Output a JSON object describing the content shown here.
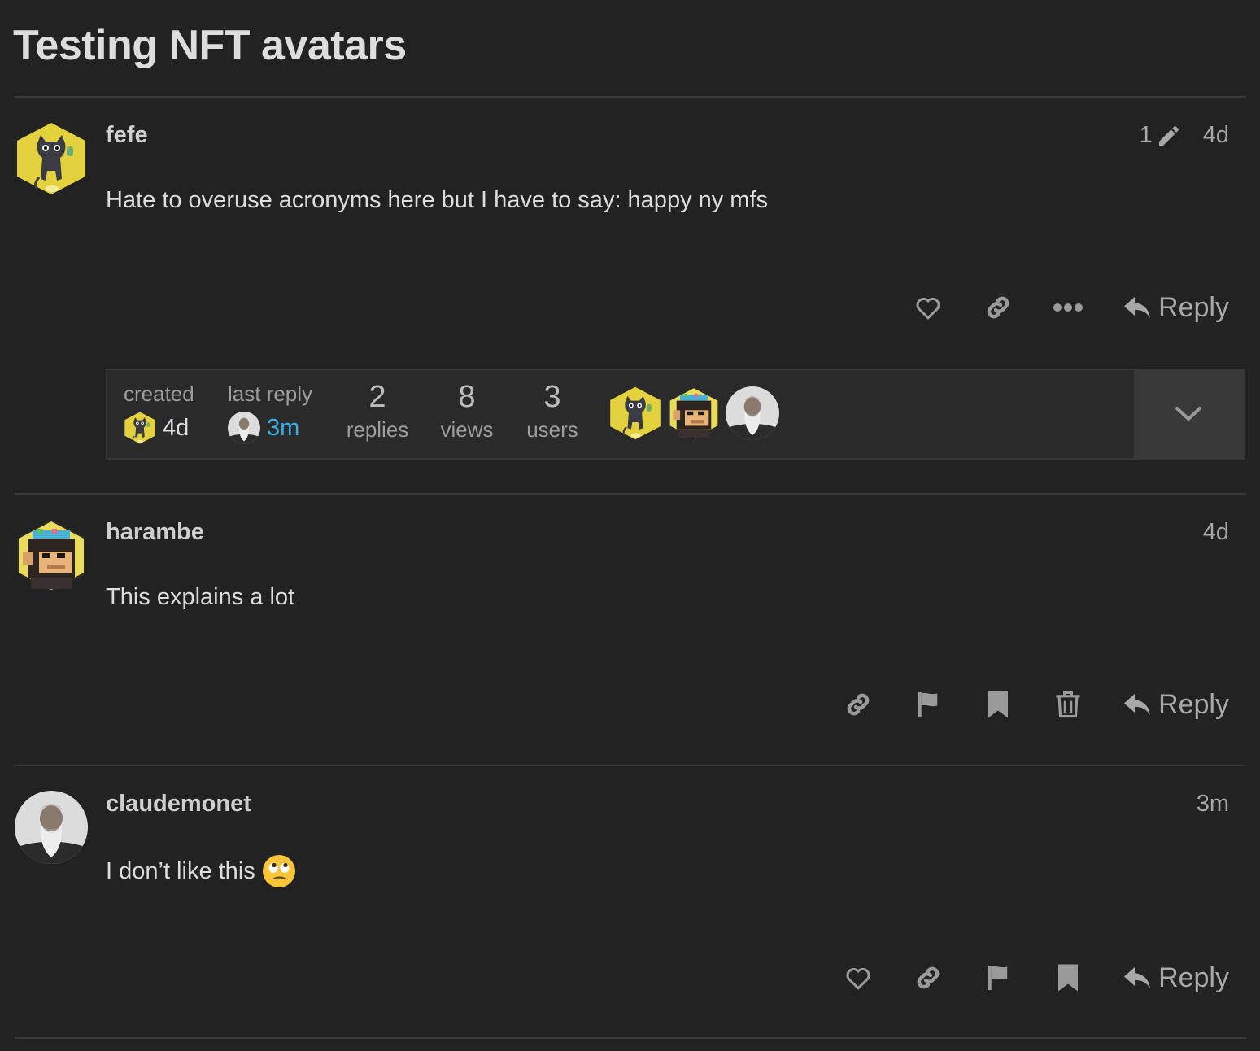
{
  "topic": {
    "title": "Testing NFT avatars"
  },
  "posts": [
    {
      "username": "fefe",
      "edit_count": "1",
      "time": "4d",
      "body": "Hate to overuse acronyms here but I have to say: happy ny mfs",
      "reply_label": "Reply"
    },
    {
      "username": "harambe",
      "time": "4d",
      "body": "This explains a lot",
      "reply_label": "Reply"
    },
    {
      "username": "claudemonet",
      "time": "3m",
      "body": "I don’t like this",
      "reply_label": "Reply"
    }
  ],
  "topic_map": {
    "created_label": "created",
    "created_time": "4d",
    "last_reply_label": "last reply",
    "last_reply_time": "3m",
    "replies_count": "2",
    "replies_label": "replies",
    "views_count": "8",
    "views_label": "views",
    "users_count": "3",
    "users_label": "users"
  },
  "colors": {
    "background": "#222222",
    "text": "#dddddd",
    "muted": "#a8a8a8",
    "link": "#3ab0e8",
    "nft_yellow": "#e8d84a"
  },
  "icons": [
    "pencil-icon",
    "heart-icon",
    "link-icon",
    "more-icon",
    "reply-icon",
    "flag-icon",
    "bookmark-icon",
    "trash-icon",
    "chevron-down-icon",
    "rolling-eyes-emoji"
  ]
}
